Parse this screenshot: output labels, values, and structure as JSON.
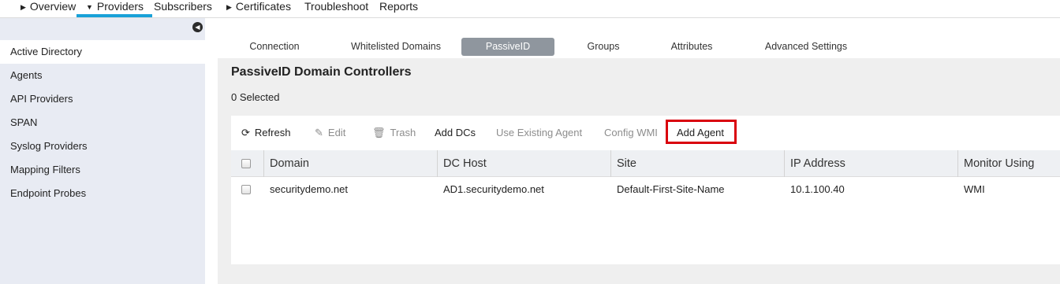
{
  "top_nav": {
    "items": [
      {
        "label": "Overview",
        "caret": "right"
      },
      {
        "label": "Providers",
        "caret": "down",
        "active": true
      },
      {
        "label": "Subscribers",
        "caret": ""
      },
      {
        "label": "Certificates",
        "caret": "right"
      },
      {
        "label": "Troubleshoot",
        "caret": ""
      },
      {
        "label": "Reports",
        "caret": ""
      }
    ],
    "accent_color": "#19a1d8"
  },
  "sidebar": {
    "collapse_icon": "chevron-left-icon",
    "items": [
      {
        "label": "Active Directory",
        "active": true
      },
      {
        "label": "Agents"
      },
      {
        "label": "API Providers"
      },
      {
        "label": "SPAN"
      },
      {
        "label": "Syslog Providers"
      },
      {
        "label": "Mapping Filters"
      },
      {
        "label": "Endpoint Probes"
      }
    ]
  },
  "tabs": [
    {
      "label": "Connection"
    },
    {
      "label": "Whitelisted Domains"
    },
    {
      "label": "PassiveID",
      "active": true
    },
    {
      "label": "Groups"
    },
    {
      "label": "Attributes"
    },
    {
      "label": "Advanced Settings"
    }
  ],
  "panel": {
    "title": "PassiveID Domain Controllers",
    "selected_count": "0 Selected"
  },
  "toolbar": {
    "refresh": "Refresh",
    "edit": "Edit",
    "trash": "Trash",
    "add_dcs": "Add DCs",
    "use_existing_agent": "Use Existing Agent",
    "config_wmi": "Config WMI",
    "add_agent": "Add Agent",
    "highlight_color": "#d9000d"
  },
  "table": {
    "columns": [
      "Domain",
      "DC Host",
      "Site",
      "IP Address",
      "Monitor Using"
    ],
    "rows": [
      {
        "domain": "securitydemo.net",
        "dc_host": "AD1.securitydemo.net",
        "site": "Default-First-Site-Name",
        "ip": "10.1.100.40",
        "monitor": "WMI"
      }
    ]
  }
}
